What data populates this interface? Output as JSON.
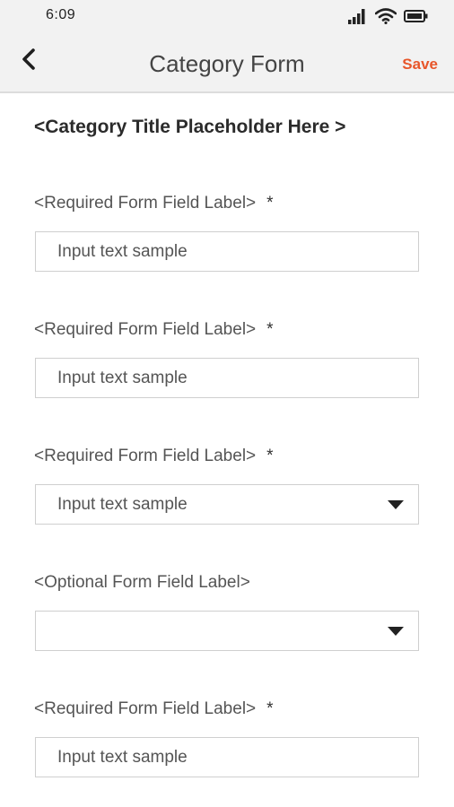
{
  "status_bar": {
    "time": "6:09",
    "icons": [
      "signal-icon",
      "wifi-icon",
      "battery-icon"
    ]
  },
  "header": {
    "back_icon": "chevron-left-icon",
    "title": "Category Form",
    "save_label": "Save"
  },
  "form": {
    "category_title": "<Category Title Placeholder Here >",
    "required_marker": "*",
    "fields": [
      {
        "label": "<Required Form Field Label>",
        "required": true,
        "type": "text",
        "value": "Input text sample"
      },
      {
        "label": "<Required Form Field Label>",
        "required": true,
        "type": "text",
        "value": "Input text sample"
      },
      {
        "label": "<Required Form Field Label>",
        "required": true,
        "type": "select",
        "value": "Input text sample"
      },
      {
        "label": "<Optional Form Field Label>",
        "required": false,
        "type": "select",
        "value": ""
      },
      {
        "label": "<Required Form Field Label>",
        "required": true,
        "type": "text",
        "value": "Input text sample"
      }
    ]
  },
  "colors": {
    "accent": "#e8562a",
    "header_bg": "#f2f2f2",
    "border": "#cfcfcf"
  }
}
